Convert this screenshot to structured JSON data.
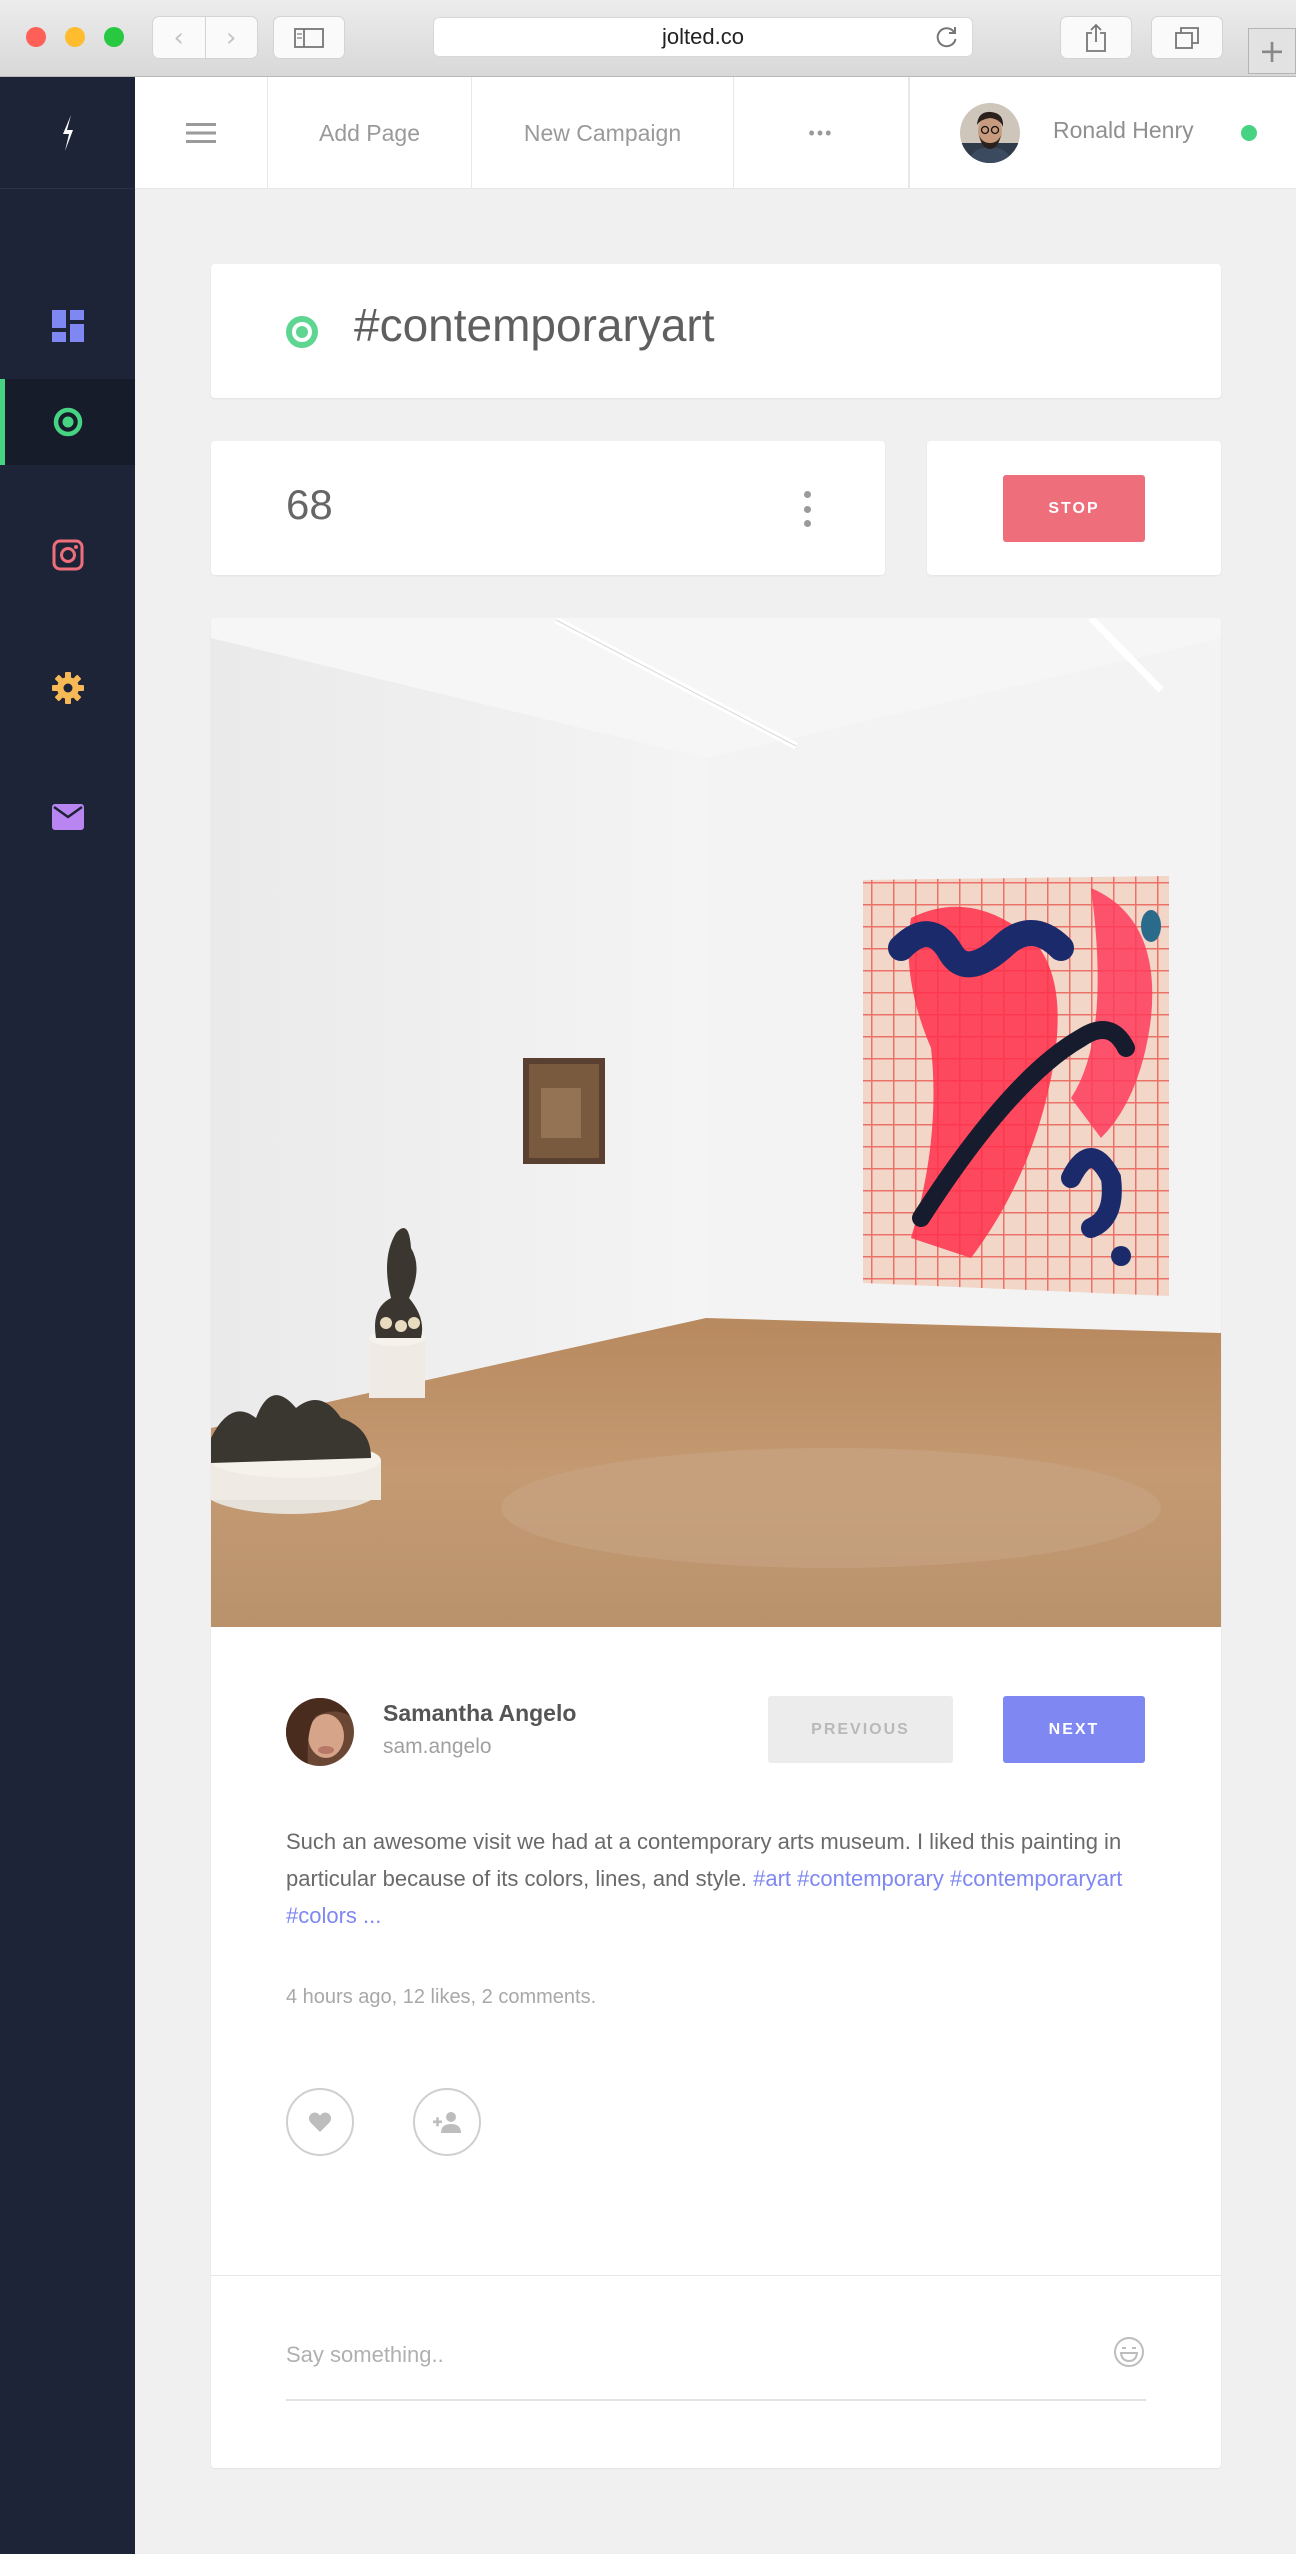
{
  "browser": {
    "url": "jolted.co",
    "back_glyph": "‹",
    "forward_glyph": "›",
    "new_tab_glyph": "+"
  },
  "sidebar": {
    "items": [
      {
        "name": "dashboard",
        "icon": "dashboard-icon",
        "color": "#7f87f2"
      },
      {
        "name": "live",
        "icon": "live-target-icon",
        "color": "#46d483",
        "active": true
      },
      {
        "name": "instagram",
        "icon": "instagram-icon",
        "color": "#ee6f7b"
      },
      {
        "name": "settings",
        "icon": "gear-icon",
        "color": "#f7b955"
      },
      {
        "name": "mail",
        "icon": "mail-icon",
        "color": "#b985f0"
      }
    ]
  },
  "topbar": {
    "add_page": "Add Page",
    "new_campaign": "New Campaign",
    "more": "•••",
    "user_name": "Ronald Henry",
    "online_color": "#46d483"
  },
  "campaign": {
    "hashtag": "#contemporaryart",
    "count": "68",
    "stop_label": "STOP"
  },
  "post": {
    "author_name": "Samantha Angelo",
    "author_handle": "sam.angelo",
    "previous_label": "PREVIOUS",
    "next_label": "NEXT",
    "caption_text": "Such an awesome visit we had at a contemporary arts museum. I liked this painting in particular because of its colors, lines, and style. ",
    "caption_tags": "#art #contemporary #contemporaryart #colors ...",
    "meta": "4 hours ago, 12 likes, 2 comments.",
    "comment_placeholder": "Say something.."
  },
  "colors": {
    "accent_blue": "#7f87f2",
    "stop_red": "#ee6f7b",
    "sidebar_bg": "#1e2437"
  }
}
